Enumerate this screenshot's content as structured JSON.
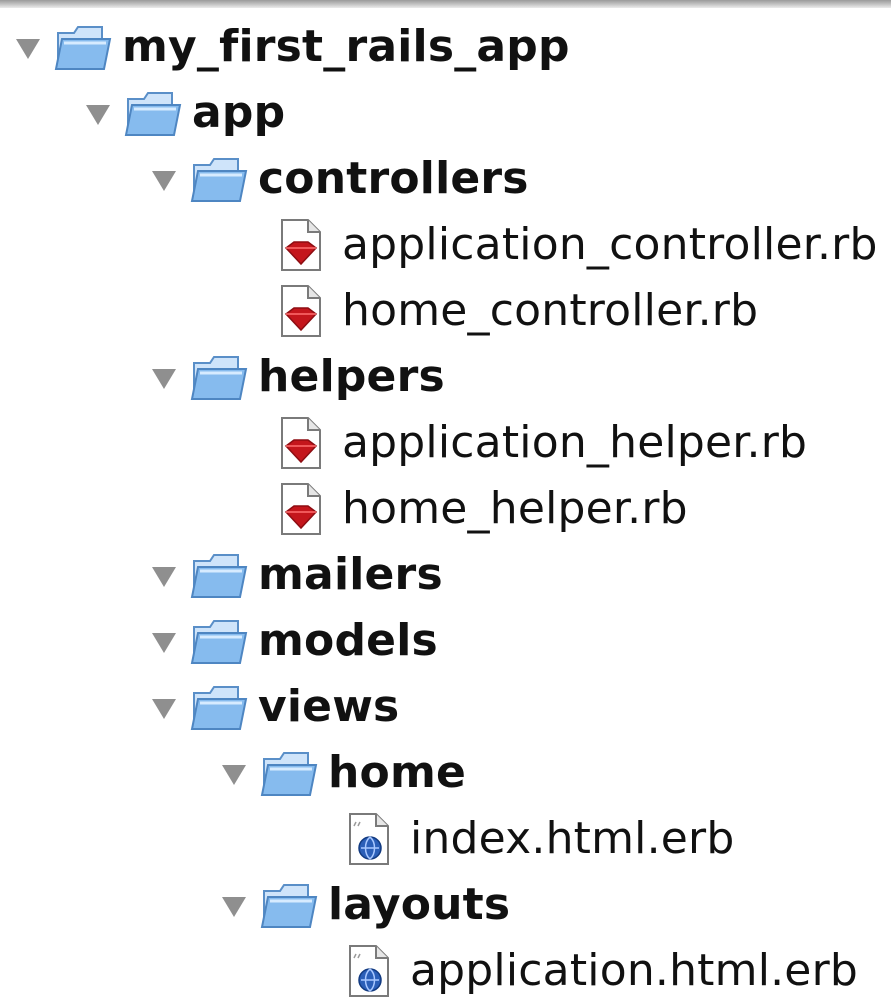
{
  "tree": {
    "root": {
      "label": "my_first_rails_app",
      "icon": "folder-icon"
    },
    "app": {
      "label": "app",
      "icon": "folder-icon"
    },
    "controllers": {
      "label": "controllers",
      "files": [
        {
          "label": "application_controller.rb",
          "icon": "ruby-file-icon"
        },
        {
          "label": "home_controller.rb",
          "icon": "ruby-file-icon"
        }
      ]
    },
    "helpers": {
      "label": "helpers",
      "files": [
        {
          "label": "application_helper.rb",
          "icon": "ruby-file-icon"
        },
        {
          "label": "home_helper.rb",
          "icon": "ruby-file-icon"
        }
      ]
    },
    "mailers": {
      "label": "mailers"
    },
    "models": {
      "label": "models"
    },
    "views": {
      "label": "views"
    },
    "home": {
      "label": "home",
      "files": [
        {
          "label": "index.html.erb",
          "icon": "erb-file-icon"
        }
      ]
    },
    "layouts": {
      "label": "layouts",
      "files": [
        {
          "label": "application.html.erb",
          "icon": "erb-file-icon"
        }
      ]
    }
  },
  "colors": {
    "folder_blue": "#7fb5ea",
    "disclosure_gray": "#8f8f8f",
    "ruby_red": "#c4161c",
    "erb_blue": "#2b5fb8"
  }
}
